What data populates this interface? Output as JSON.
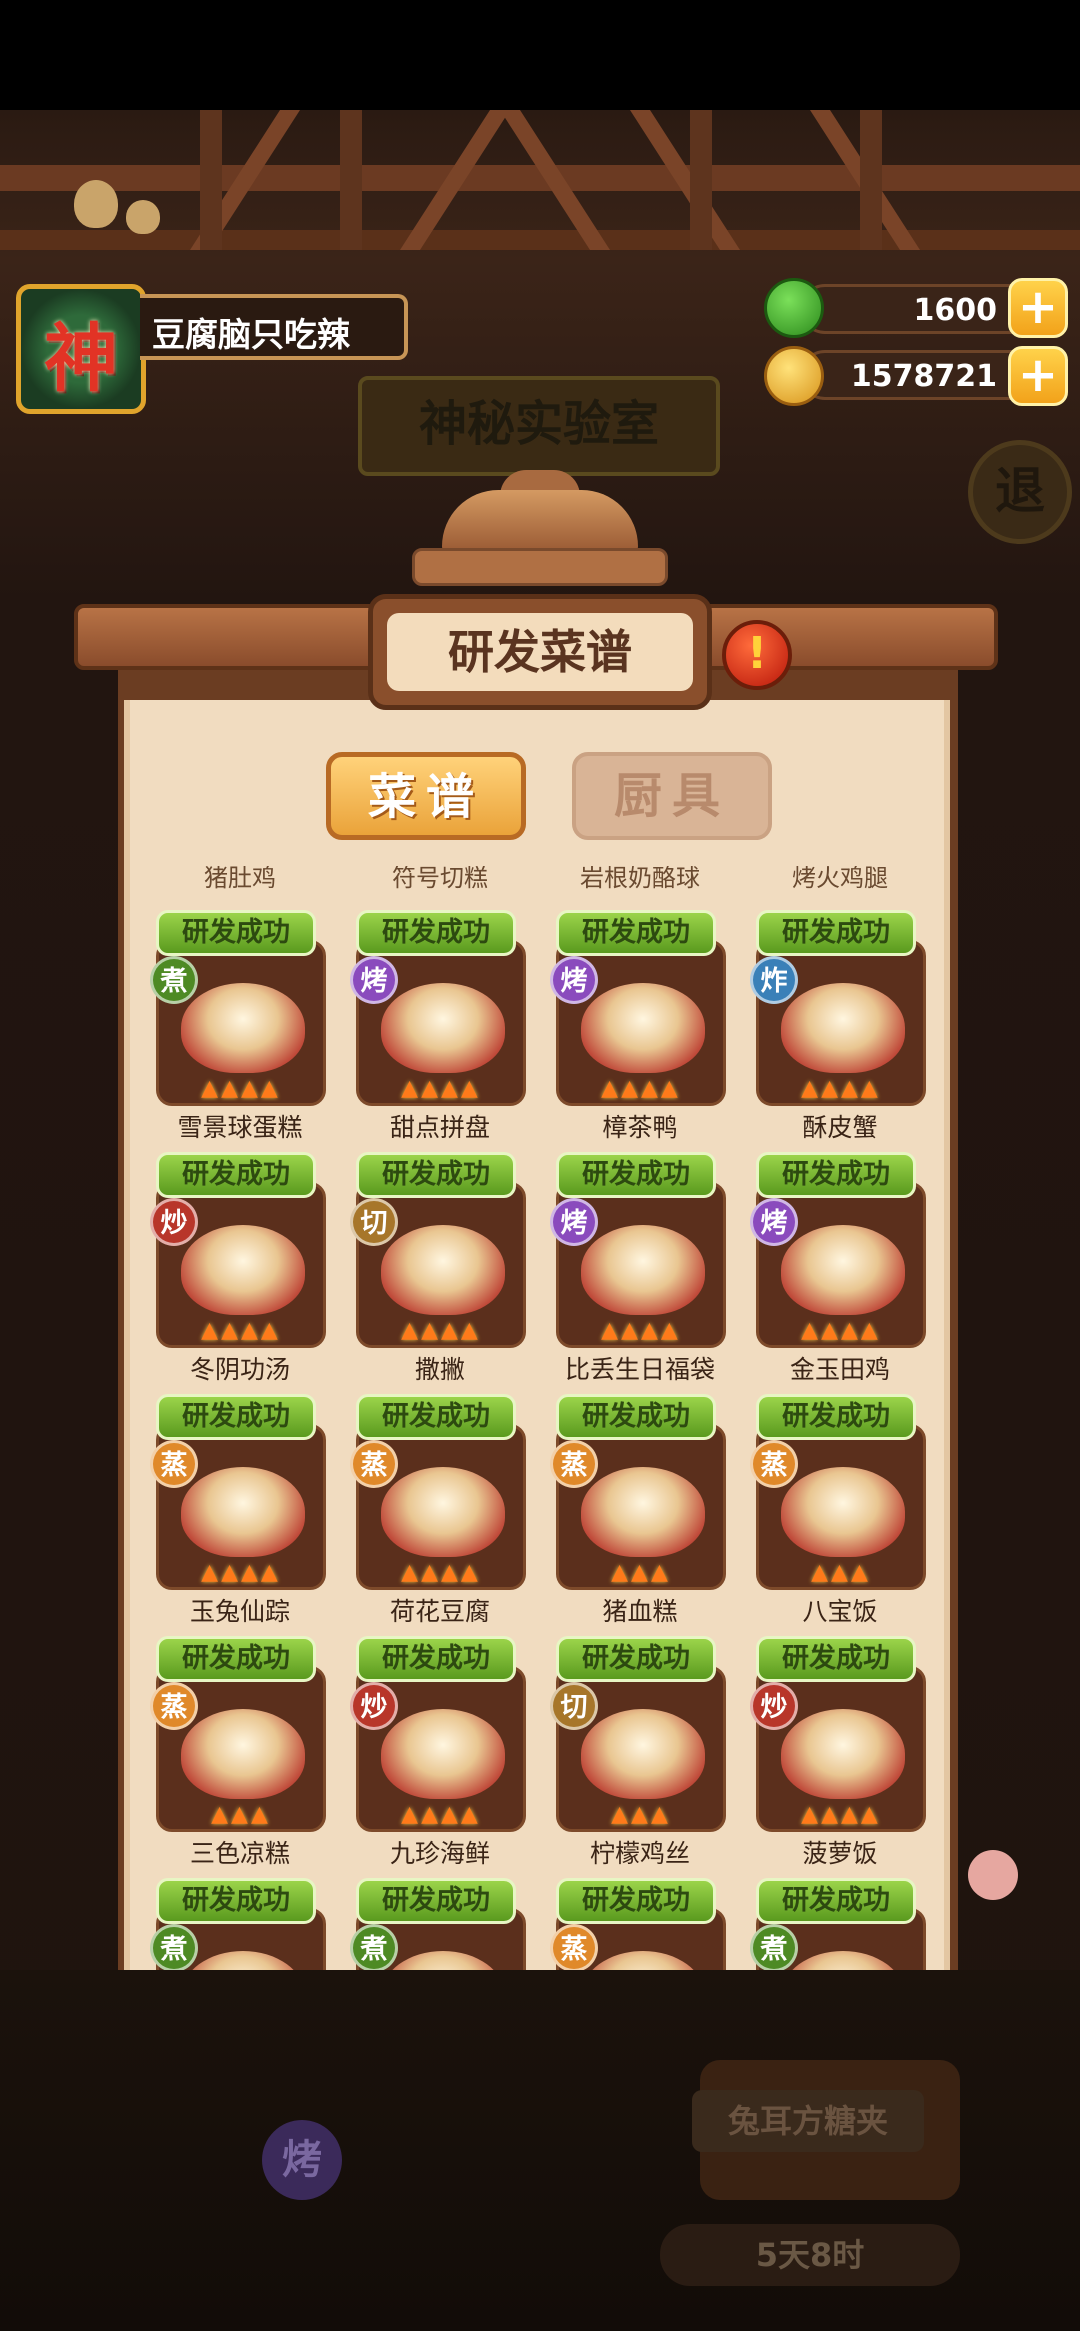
{
  "player": {
    "name": "豆腐脑只吃辣",
    "avatar_char": "神"
  },
  "currencies": [
    {
      "name": "jade",
      "value": "1600",
      "color": "#3fae2a"
    },
    {
      "name": "coin",
      "value": "1578721",
      "color": "#f2b233"
    }
  ],
  "background": {
    "room_title": "神秘实验室",
    "back_label": "退",
    "station_label": "兔耳方糖夹",
    "station_method": "烤",
    "timer": "5天8时"
  },
  "panel": {
    "title": "研发菜谱",
    "alert": "!",
    "tabs": [
      "菜谱",
      "厨具"
    ],
    "active_tab": "菜谱"
  },
  "partial_names": [
    "猪肚鸡",
    "符号切糕",
    "岩根奶酪球",
    "烤火鸡腿"
  ],
  "badge_label": "研发成功",
  "recipes": [
    {
      "name": "雪景球蛋糕",
      "method": "煮",
      "method_color": "green",
      "flames": 4
    },
    {
      "name": "甜点拼盘",
      "method": "烤",
      "method_color": "purple",
      "flames": 4
    },
    {
      "name": "樟茶鸭",
      "method": "烤",
      "method_color": "purple",
      "flames": 4
    },
    {
      "name": "酥皮蟹",
      "method": "炸",
      "method_color": "blue",
      "flames": 4
    },
    {
      "name": "冬阴功汤",
      "method": "炒",
      "method_color": "red",
      "flames": 4
    },
    {
      "name": "撒撇",
      "method": "切",
      "method_color": "gold",
      "flames": 4
    },
    {
      "name": "比丢生日福袋",
      "method": "烤",
      "method_color": "purple",
      "flames": 4
    },
    {
      "name": "金玉田鸡",
      "method": "烤",
      "method_color": "purple",
      "flames": 4
    },
    {
      "name": "玉兔仙踪",
      "method": "蒸",
      "method_color": "orange",
      "flames": 4
    },
    {
      "name": "荷花豆腐",
      "method": "蒸",
      "method_color": "orange",
      "flames": 4
    },
    {
      "name": "猪血糕",
      "method": "蒸",
      "method_color": "orange",
      "flames": 3
    },
    {
      "name": "八宝饭",
      "method": "蒸",
      "method_color": "orange",
      "flames": 3
    },
    {
      "name": "三色凉糕",
      "method": "蒸",
      "method_color": "orange",
      "flames": 3
    },
    {
      "name": "九珍海鲜",
      "method": "炒",
      "method_color": "red",
      "flames": 4
    },
    {
      "name": "柠檬鸡丝",
      "method": "切",
      "method_color": "gold",
      "flames": 3
    },
    {
      "name": "菠萝饭",
      "method": "炒",
      "method_color": "red",
      "flames": 4
    },
    {
      "name": "",
      "method": "煮",
      "method_color": "green",
      "flames": 0
    },
    {
      "name": "",
      "method": "煮",
      "method_color": "green",
      "flames": 0
    },
    {
      "name": "",
      "method": "蒸",
      "method_color": "orange",
      "flames": 0
    },
    {
      "name": "",
      "method": "煮",
      "method_color": "green",
      "flames": 0
    }
  ]
}
